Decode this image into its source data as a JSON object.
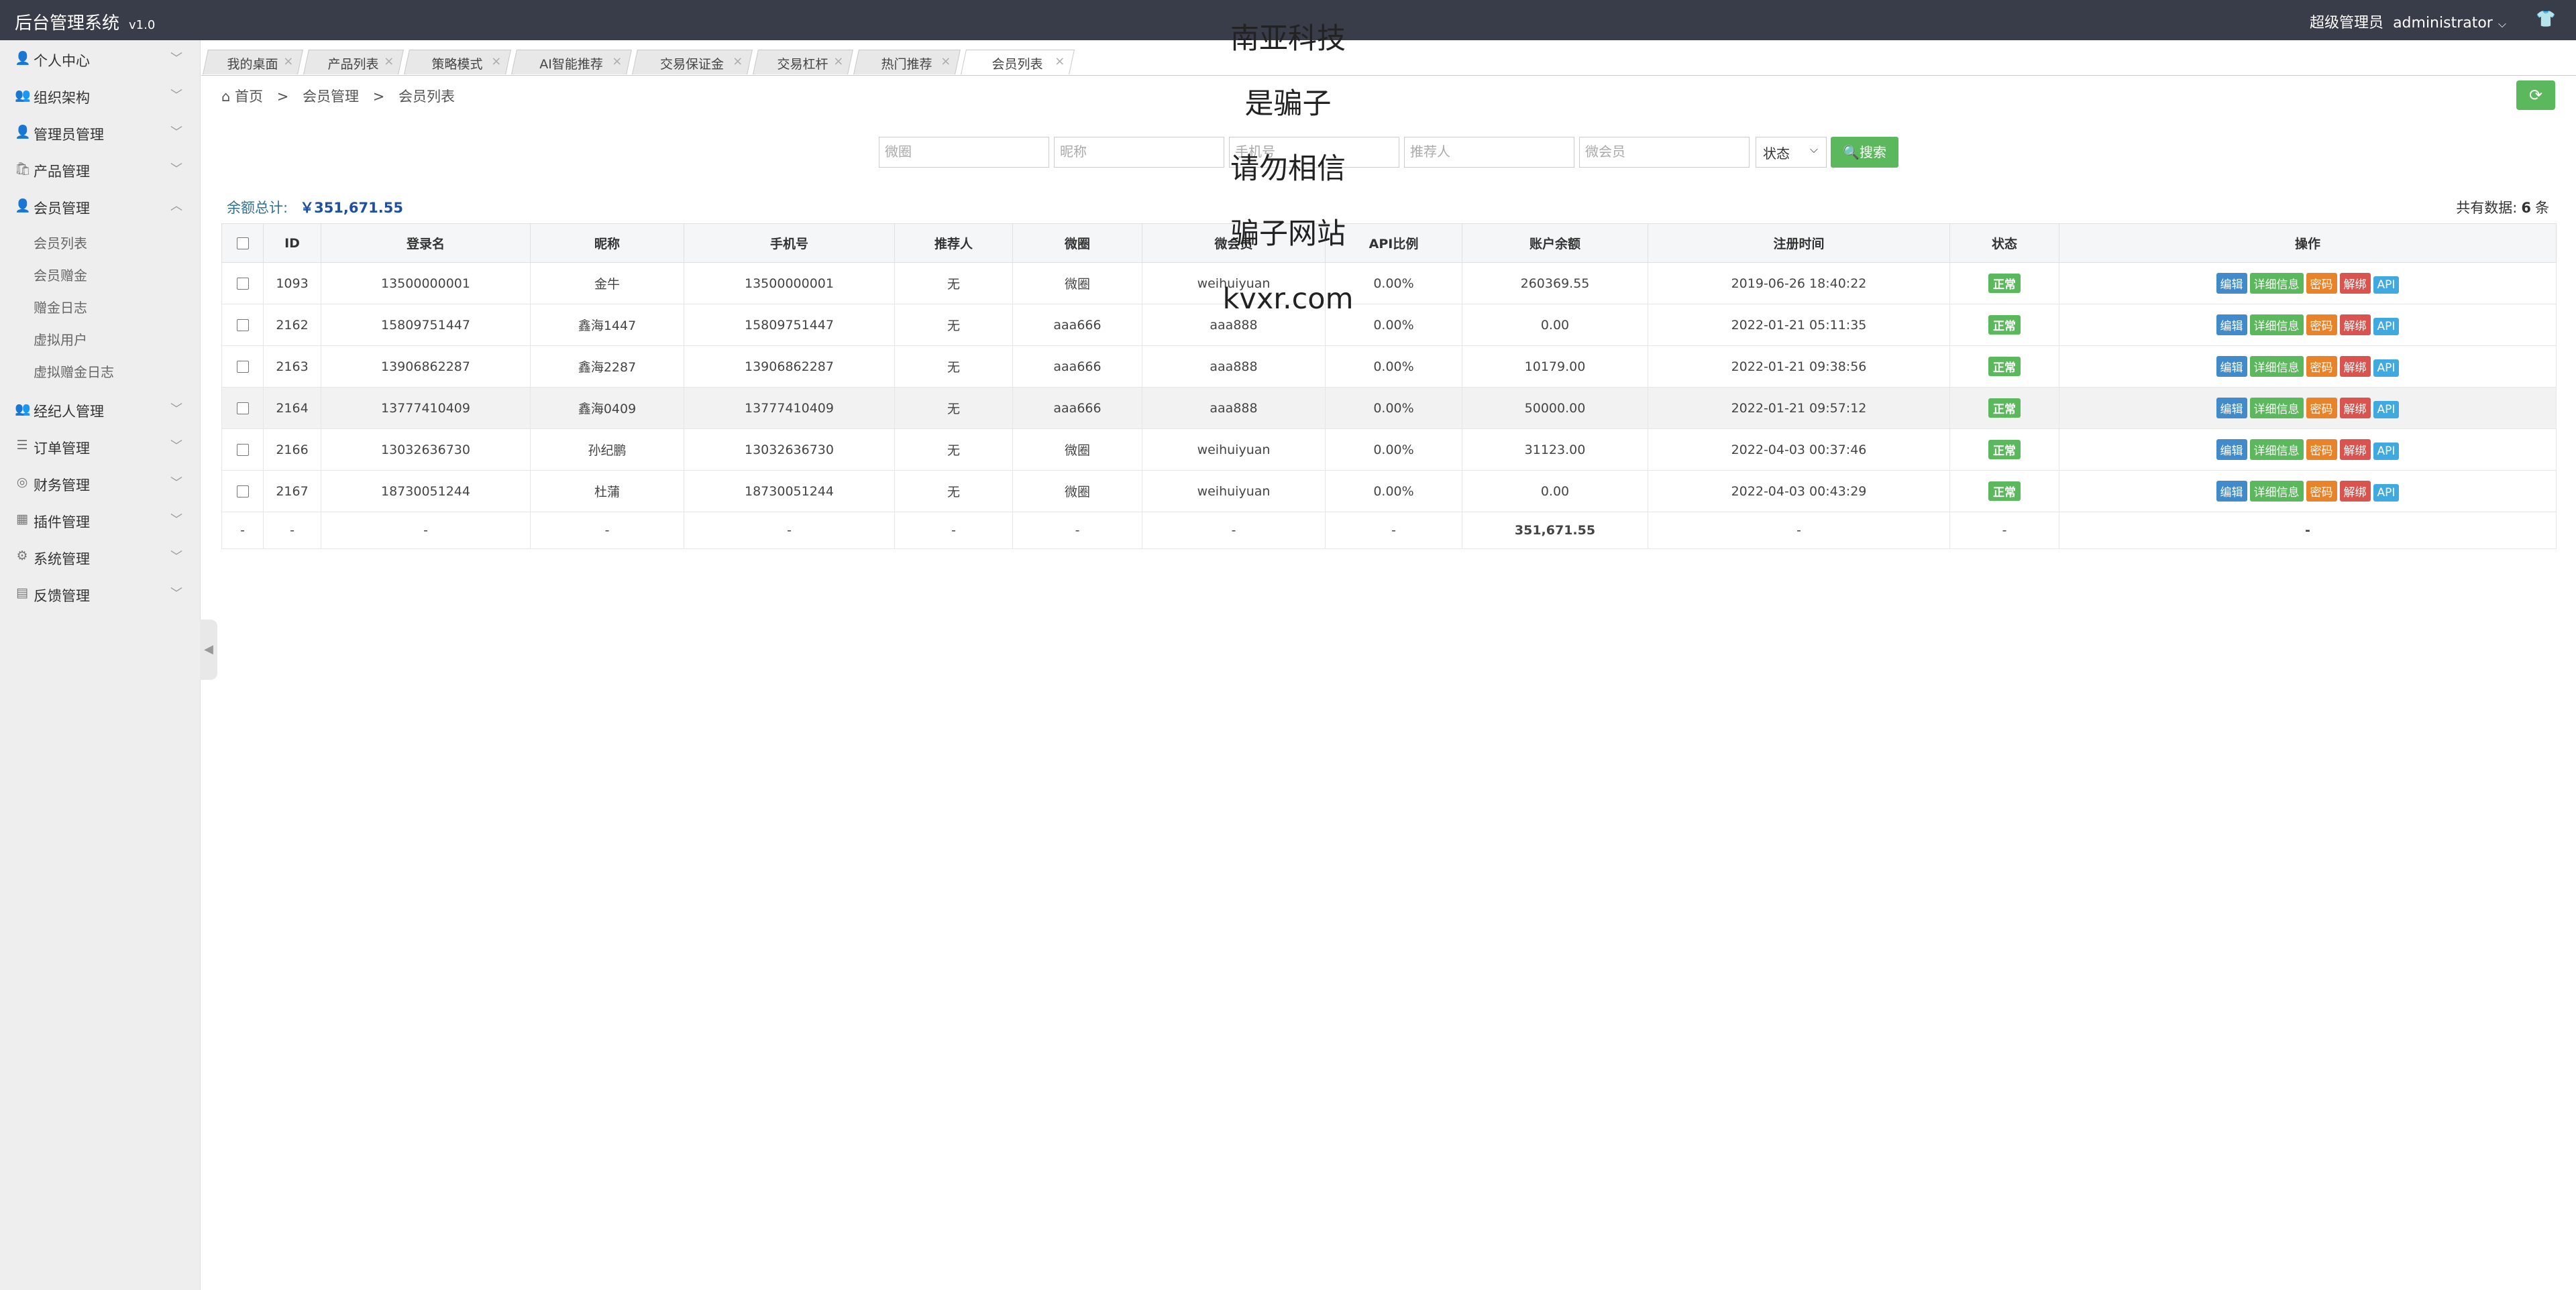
{
  "app": {
    "title": "后台管理系统",
    "version": "v1.0"
  },
  "header": {
    "role": "超级管理员",
    "username": "administrator"
  },
  "sidebar": {
    "items": [
      {
        "label": "个人中心",
        "icon": "user-icon",
        "glyph": "👤"
      },
      {
        "label": "组织架构",
        "icon": "group-icon",
        "glyph": "👥"
      },
      {
        "label": "管理员管理",
        "icon": "user-icon",
        "glyph": "👤"
      },
      {
        "label": "产品管理",
        "icon": "bag-icon",
        "glyph": "🛍"
      },
      {
        "label": "会员管理",
        "icon": "member-icon",
        "glyph": "👤",
        "expanded": true,
        "children": [
          "会员列表",
          "会员赠金",
          "赠金日志",
          "虚拟用户",
          "虚拟赠金日志"
        ]
      },
      {
        "label": "经纪人管理",
        "icon": "broker-icon",
        "glyph": "👥"
      },
      {
        "label": "订单管理",
        "icon": "order-icon",
        "glyph": "☰"
      },
      {
        "label": "财务管理",
        "icon": "finance-icon",
        "glyph": "◎"
      },
      {
        "label": "插件管理",
        "icon": "plugin-icon",
        "glyph": "▦"
      },
      {
        "label": "系统管理",
        "icon": "gear-icon",
        "glyph": "⚙"
      },
      {
        "label": "反馈管理",
        "icon": "feedback-icon",
        "glyph": "▤"
      }
    ]
  },
  "tabs": [
    {
      "label": "我的桌面"
    },
    {
      "label": "产品列表"
    },
    {
      "label": "策略模式"
    },
    {
      "label": "AI智能推荐"
    },
    {
      "label": "交易保证金"
    },
    {
      "label": "交易杠杆"
    },
    {
      "label": "热门推荐"
    },
    {
      "label": "会员列表",
      "active": true
    }
  ],
  "breadcrumb": {
    "home": "首页",
    "section": "会员管理",
    "page": "会员列表"
  },
  "search": {
    "placeholders": [
      "微圈",
      "昵称",
      "手机号",
      "推荐人",
      "微会员"
    ],
    "status_label": "状态",
    "button_label": "搜索"
  },
  "summary": {
    "label": "余额总计:",
    "amount": "￥351,671.55"
  },
  "total": {
    "prefix": "共有数据:",
    "count": "6",
    "suffix": "条"
  },
  "table": {
    "headers": [
      "ID",
      "登录名",
      "昵称",
      "手机号",
      "推荐人",
      "微圈",
      "微会员",
      "API比例",
      "账户余额",
      "注册时间",
      "状态",
      "操作"
    ],
    "rows": [
      [
        "1093",
        "13500000001",
        "金牛",
        "13500000001",
        "无",
        "微圈",
        "weihuiyuan",
        "0.00%",
        "260369.55",
        "2019-06-26 18:40:22",
        "正常"
      ],
      [
        "2162",
        "15809751447",
        "鑫海1447",
        "15809751447",
        "无",
        "aaa666",
        "aaa888",
        "0.00%",
        "0.00",
        "2022-01-21 05:11:35",
        "正常"
      ],
      [
        "2163",
        "13906862287",
        "鑫海2287",
        "13906862287",
        "无",
        "aaa666",
        "aaa888",
        "0.00%",
        "10179.00",
        "2022-01-21 09:38:56",
        "正常"
      ],
      [
        "2164",
        "13777410409",
        "鑫海0409",
        "13777410409",
        "无",
        "aaa666",
        "aaa888",
        "0.00%",
        "50000.00",
        "2022-01-21 09:57:12",
        "正常"
      ],
      [
        "2166",
        "13032636730",
        "孙纪鹏",
        "13032636730",
        "无",
        "微圈",
        "weihuiyuan",
        "0.00%",
        "31123.00",
        "2022-04-03 00:37:46",
        "正常"
      ],
      [
        "2167",
        "18730051244",
        "杜蒲",
        "18730051244",
        "无",
        "微圈",
        "weihuiyuan",
        "0.00%",
        "0.00",
        "2022-04-03 00:43:29",
        "正常"
      ]
    ],
    "summary_row": [
      "-",
      "-",
      "-",
      "-",
      "-",
      "-",
      "-",
      "-",
      "-",
      "351,671.55",
      "-",
      "-",
      "-"
    ],
    "actions": [
      {
        "label": "编辑",
        "color": "#428bca"
      },
      {
        "label": "详细信息",
        "color": "#5cb85c"
      },
      {
        "label": "密码",
        "color": "#e8832a"
      },
      {
        "label": "解绑",
        "color": "#d9534f"
      },
      {
        "label": "API",
        "color": "#3fa9e0"
      }
    ]
  },
  "watermark": [
    "南亚科技",
    "是骗子",
    "请勿相信",
    "骗子网站",
    "kvxr.com"
  ]
}
